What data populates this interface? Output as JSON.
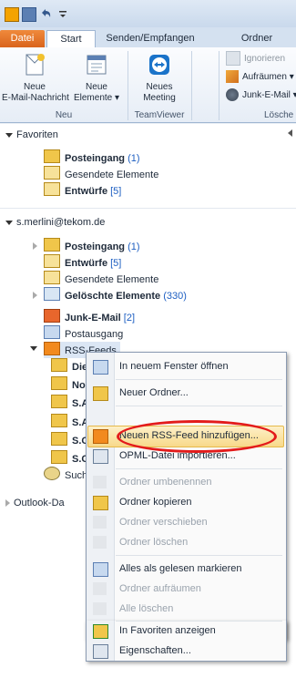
{
  "ribbon_tabs": [
    "Datei",
    "Start",
    "Senden/Empfangen",
    "Ordner"
  ],
  "ribbon": {
    "new_mail": "Neue\nE-Mail-Nachricht",
    "new_items": "Neue\nElemente ▾",
    "new_meeting": "Neues\nMeeting",
    "ignore": "Ignorieren",
    "cleanup": "Aufräumen ▾",
    "junk": "Junk-E-Mail ▾",
    "group_new": "Neu",
    "group_teamviewer": "TeamViewer",
    "group_delete": "Lösche"
  },
  "favorites": {
    "header": "Favoriten",
    "items": [
      {
        "label": "Posteingang",
        "count": "(1)",
        "bold": true
      },
      {
        "label": "Gesendete Elemente",
        "count": "",
        "bold": false
      },
      {
        "label": "Entwürfe",
        "count": "[5]",
        "bold": true
      }
    ]
  },
  "account": {
    "header": "s.merlini@tekom.de",
    "items": [
      {
        "label": "Posteingang",
        "count": "(1)",
        "bold": true
      },
      {
        "label": "Entwürfe",
        "count": "[5]",
        "bold": true
      },
      {
        "label": "Gesendete Elemente",
        "count": "",
        "bold": false
      },
      {
        "label": "Gelöschte Elemente",
        "count": "(330)",
        "bold": true
      },
      {
        "label": "Junk-E-Mail",
        "count": "[2]",
        "bold": true
      },
      {
        "label": "Postausgang",
        "count": "",
        "bold": false
      },
      {
        "label": "RSS-Feeds",
        "count": "",
        "bold": false
      }
    ],
    "rss_children": [
      "Dier",
      "Nor",
      "S.Ar",
      "S.Ar",
      "S.Ge",
      "S.Ge"
    ],
    "search_folder": "Sucho",
    "outlook_data": "Outlook-Da"
  },
  "context_menu": [
    {
      "label": "In neuem Fenster öffnen",
      "enabled": true
    },
    {
      "label": "Neuer Ordner...",
      "enabled": true
    },
    {
      "label": "Neuen RSS-Feed hinzufügen...",
      "enabled": true,
      "highlighted": true
    },
    {
      "label": "OPML-Datei importieren...",
      "enabled": true
    },
    {
      "label": "Ordner umbenennen",
      "enabled": false
    },
    {
      "label": "Ordner kopieren",
      "enabled": true
    },
    {
      "label": "Ordner verschieben",
      "enabled": false
    },
    {
      "label": "Ordner löschen",
      "enabled": false
    },
    {
      "label": "Alles als gelesen markieren",
      "enabled": true
    },
    {
      "label": "Ordner aufräumen",
      "enabled": false
    },
    {
      "label": "Alle löschen",
      "enabled": false
    },
    {
      "label": "In Favoriten anzeigen",
      "enabled": true
    },
    {
      "label": "Eigenschaften...",
      "enabled": true
    }
  ],
  "colors": {
    "accent": "#e31b1b",
    "file_tab": "#e0702a",
    "highlight": "#f8d98a"
  }
}
